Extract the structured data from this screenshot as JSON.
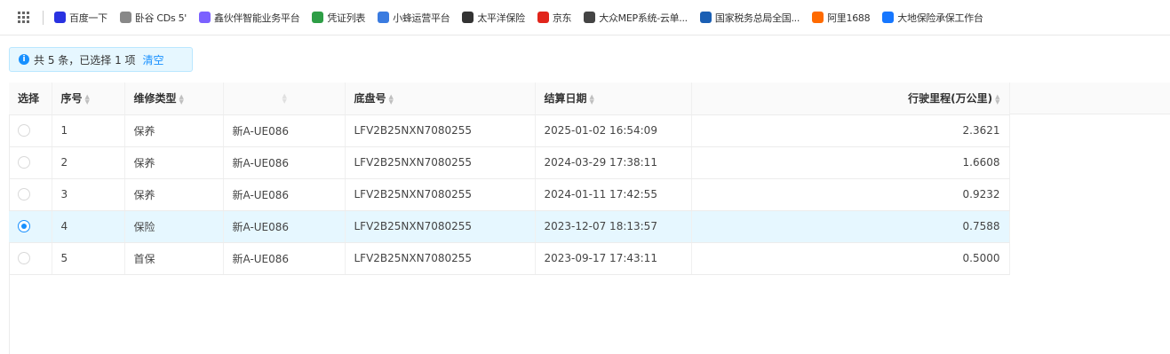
{
  "bookmarks": [
    {
      "label": "百度一下",
      "icon": "baidu-icon",
      "color": "#2932e1"
    },
    {
      "label": "卧谷 CDs 5'",
      "icon": "link-icon",
      "color": "#888888"
    },
    {
      "label": "鑫伙伴智能业务平台",
      "icon": "platform-icon",
      "color": "#7b61ff"
    },
    {
      "label": "凭证列表",
      "icon": "voucher-icon",
      "color": "#2e9e46"
    },
    {
      "label": "小蜂运营平台",
      "icon": "ops-icon",
      "color": "#3a7be0"
    },
    {
      "label": "太平洋保险",
      "icon": "globe-icon",
      "color": "#333333"
    },
    {
      "label": "京东",
      "icon": "jd-icon",
      "color": "#e1251b"
    },
    {
      "label": "大众MEP系统-云单...",
      "icon": "vw-icon",
      "color": "#444444"
    },
    {
      "label": "国家税务总局全国...",
      "icon": "tax-icon",
      "color": "#1a5fb4"
    },
    {
      "label": "阿里1688",
      "icon": "ali-icon",
      "color": "#ff6a00"
    },
    {
      "label": "大地保险承保工作台",
      "icon": "dadi-icon",
      "color": "#1677ff"
    }
  ],
  "alert": {
    "info_glyph": "i",
    "text": "共 5 条，已选择 1 项",
    "clear_label": "清空"
  },
  "table": {
    "headers": {
      "select": "选择",
      "seq": "序号",
      "repair_type": "维修类型",
      "plate": "",
      "vin": "底盘号",
      "settle_date": "结算日期",
      "mileage": "行驶里程(万公里)"
    },
    "rows": [
      {
        "seq": "1",
        "repair_type": "保养",
        "plate": "新A-UE086",
        "vin": "LFV2B25NXN7080255",
        "settle_date": "2025-01-02 16:54:09",
        "mileage": "2.3621",
        "selected": false
      },
      {
        "seq": "2",
        "repair_type": "保养",
        "plate": "新A-UE086",
        "vin": "LFV2B25NXN7080255",
        "settle_date": "2024-03-29 17:38:11",
        "mileage": "1.6608",
        "selected": false
      },
      {
        "seq": "3",
        "repair_type": "保养",
        "plate": "新A-UE086",
        "vin": "LFV2B25NXN7080255",
        "settle_date": "2024-01-11 17:42:55",
        "mileage": "0.9232",
        "selected": false
      },
      {
        "seq": "4",
        "repair_type": "保险",
        "plate": "新A-UE086",
        "vin": "LFV2B25NXN7080255",
        "settle_date": "2023-12-07 18:13:57",
        "mileage": "0.7588",
        "selected": true
      },
      {
        "seq": "5",
        "repair_type": "首保",
        "plate": "新A-UE086",
        "vin": "LFV2B25NXN7080255",
        "settle_date": "2023-09-17 17:43:11",
        "mileage": "0.5000",
        "selected": false
      }
    ],
    "selected_row_color": "#e6f7ff",
    "accent_color": "#1890ff"
  }
}
